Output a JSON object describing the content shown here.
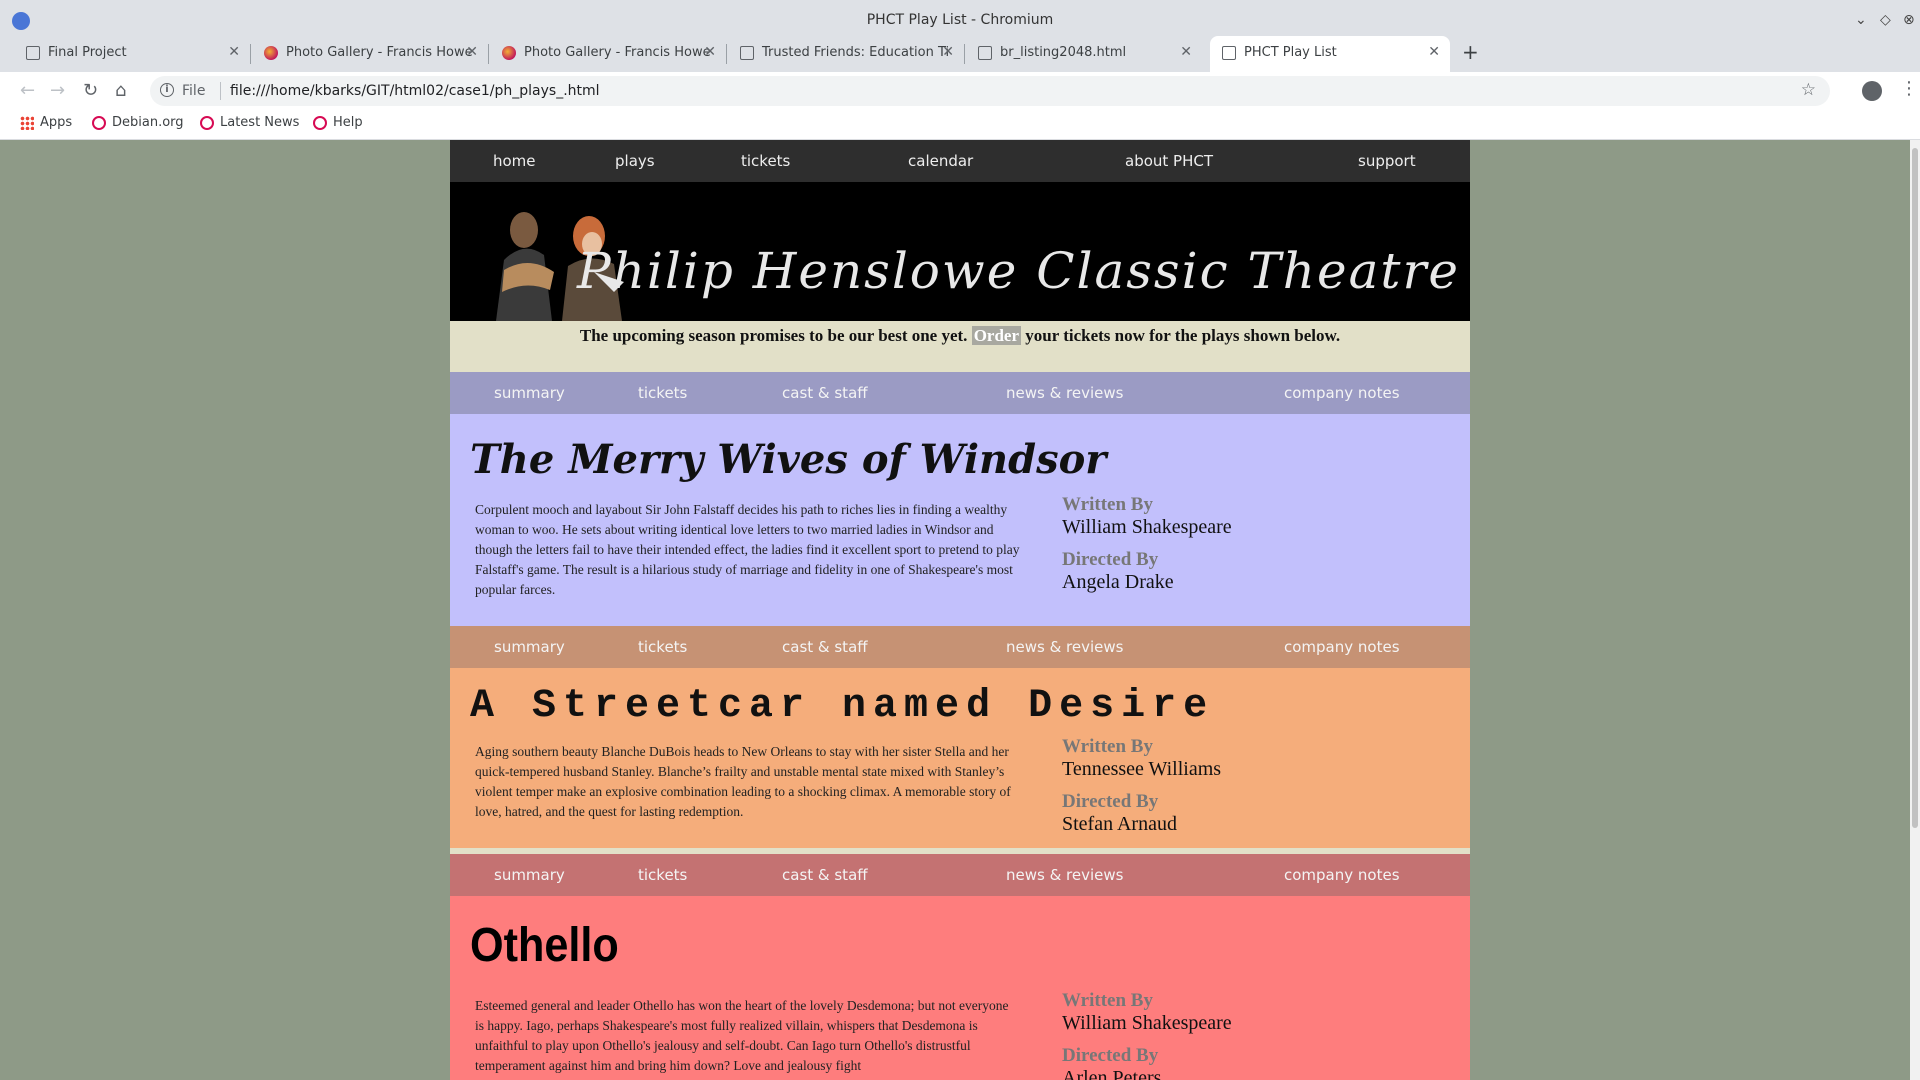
{
  "window": {
    "title": "PHCT Play List - Chromium",
    "controls": {
      "minimize": "⌄",
      "restore": "◇",
      "close": "⊗"
    }
  },
  "tabs": [
    {
      "label": "Final Project",
      "icon": "doc-icon"
    },
    {
      "label": "Photo Gallery - Francis Howe",
      "icon": "globe-icon"
    },
    {
      "label": "Photo Gallery - Francis Howe",
      "icon": "globe-icon"
    },
    {
      "label": "Trusted Friends: Education Ti",
      "icon": "doc-icon"
    },
    {
      "label": "br_listing2048.html",
      "icon": "doc-icon"
    },
    {
      "label": "PHCT Play List",
      "icon": "doc-icon",
      "active": true
    }
  ],
  "toolbar": {
    "scheme": "File",
    "url": "file:///home/kbarks/GIT/html02/case1/ph_plays_.html"
  },
  "bookmarks": [
    {
      "label": "Apps",
      "icon": "apps-icon"
    },
    {
      "label": "Debian.org",
      "icon": "debian-swirl-icon"
    },
    {
      "label": "Latest News",
      "icon": "debian-swirl-icon"
    },
    {
      "label": "Help",
      "icon": "debian-swirl-icon"
    }
  ],
  "site": {
    "nav": [
      "home",
      "plays",
      "tickets",
      "calendar",
      "about PHCT",
      "support"
    ],
    "banner_title": "Philip Henslowe Classic Theatre",
    "intro": {
      "before": "The upcoming season promises to be our best one yet.",
      "highlight": "Order",
      "after": "your tickets now for the plays shown below."
    },
    "subnav": [
      "summary",
      "tickets",
      "cast & staff",
      "news & reviews",
      "company notes"
    ],
    "labels": {
      "written_by": "Written By",
      "directed_by": "Directed By"
    },
    "colors": {
      "page_bg": "#8e9a87",
      "nav_bg": "#2e2e2e",
      "intro_bg": "#e2e0c8",
      "play1_nav": "#9b9bc4",
      "play1_bg": "#c2c0fc",
      "play2_nav": "#c69274",
      "play2_bg": "#f5ad7b",
      "play3_nav": "#c47272",
      "play3_bg": "#fe7d7d"
    },
    "plays": [
      {
        "title": "The Merry Wives of Windsor",
        "summary": "Corpulent mooch and layabout Sir John Falstaff decides his path to riches lies in finding a wealthy woman to woo. He sets about writing identical love letters to two married ladies in Windsor and though the letters fail to have their intended effect, the ladies find it excellent sport to pretend to play Falstaff's game. The result is a hilarious study of marriage and fidelity in one of Shakespeare's most popular farces.",
        "written_by": "William Shakespeare",
        "directed_by": "Angela Drake"
      },
      {
        "title": "A Streetcar named Desire",
        "summary": "Aging southern beauty Blanche DuBois heads to New Orleans to stay with her sister Stella and her quick-tempered husband Stanley. Blanche’s frailty and unstable mental state mixed with Stanley’s violent temper make an explosive combination leading to a shocking climax. A memorable story of love, hatred, and the quest for lasting redemption.",
        "written_by": "Tennessee Williams",
        "directed_by": "Stefan Arnaud"
      },
      {
        "title": "Othello",
        "summary": "Esteemed general and leader Othello has won the heart of the lovely Desdemona; but not everyone is happy. Iago, perhaps Shakespeare's most fully realized villain, whispers that Desdemona is unfaithful to play upon Othello's jealousy and self-doubt. Can Iago turn Othello's distrustful temperament against him and bring him down? Love and jealousy fight",
        "written_by": "William Shakespeare",
        "directed_by": "Arlen Peters"
      }
    ]
  }
}
